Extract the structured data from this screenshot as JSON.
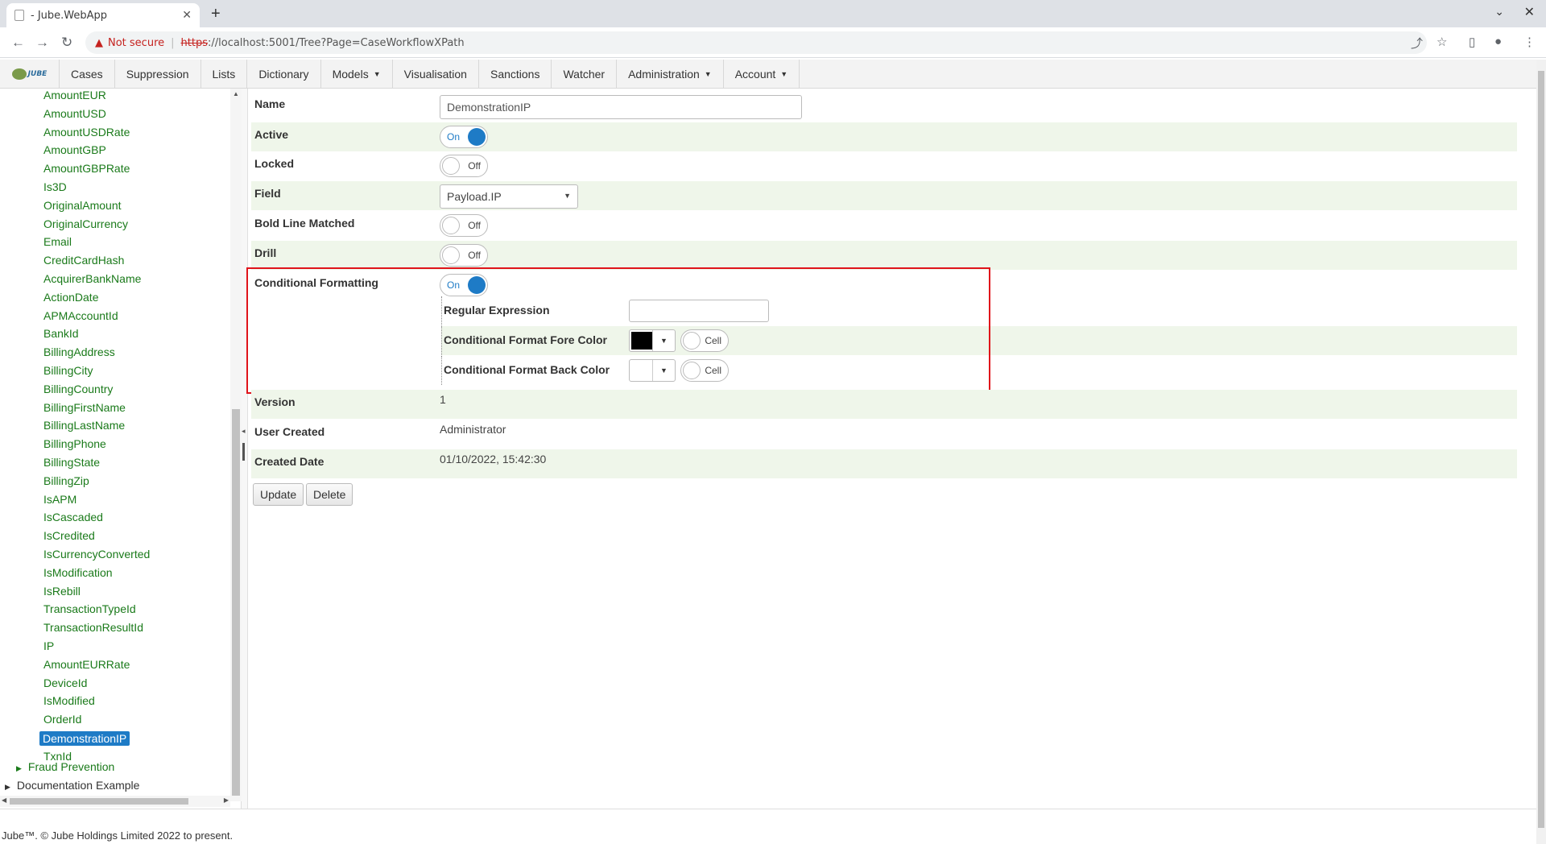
{
  "browser": {
    "tab_title": "- Jube.WebApp",
    "not_secure": "Not secure",
    "url_scheme": "https",
    "url_rest": "://localhost:5001/Tree?Page=CaseWorkflowXPath"
  },
  "nav": {
    "logo_text": "JUBE",
    "items": [
      {
        "label": "Cases",
        "dropdown": false
      },
      {
        "label": "Suppression",
        "dropdown": false
      },
      {
        "label": "Lists",
        "dropdown": false
      },
      {
        "label": "Dictionary",
        "dropdown": false
      },
      {
        "label": "Models",
        "dropdown": true
      },
      {
        "label": "Visualisation",
        "dropdown": false
      },
      {
        "label": "Sanctions",
        "dropdown": false
      },
      {
        "label": "Watcher",
        "dropdown": false
      },
      {
        "label": "Administration",
        "dropdown": true
      },
      {
        "label": "Account",
        "dropdown": true
      }
    ]
  },
  "tree": {
    "items": [
      "AmountEUR",
      "AmountUSD",
      "AmountUSDRate",
      "AmountGBP",
      "AmountGBPRate",
      "Is3D",
      "OriginalAmount",
      "OriginalCurrency",
      "Email",
      "CreditCardHash",
      "AcquirerBankName",
      "ActionDate",
      "APMAccountId",
      "BankId",
      "BillingAddress",
      "BillingCity",
      "BillingCountry",
      "BillingFirstName",
      "BillingLastName",
      "BillingPhone",
      "BillingState",
      "BillingZip",
      "IsAPM",
      "IsCascaded",
      "IsCredited",
      "IsCurrencyConverted",
      "IsModification",
      "IsRebill",
      "TransactionTypeId",
      "TransactionResultId",
      "IP",
      "AmountEURRate",
      "DeviceId",
      "IsModified",
      "OrderId",
      "DemonstrationIP",
      "TxnId"
    ],
    "selected": "DemonstrationIP",
    "fraud_prevention": "Fraud Prevention",
    "documentation_example": "Documentation Example"
  },
  "form": {
    "name_label": "Name",
    "name_value": "DemonstrationIP",
    "active_label": "Active",
    "active_state": "On",
    "locked_label": "Locked",
    "locked_state": "Off",
    "field_label": "Field",
    "field_value": "Payload.IP",
    "bold_label": "Bold Line Matched",
    "bold_state": "Off",
    "drill_label": "Drill",
    "drill_state": "Off",
    "cond_label": "Conditional Formatting",
    "cond_state": "On",
    "regex_label": "Regular Expression",
    "regex_value": "",
    "fore_label": "Conditional Format Fore Color",
    "fore_color": "#000000",
    "fore_cell": "Cell",
    "back_label": "Conditional Format Back Color",
    "back_color": "#ffffff",
    "back_cell": "Cell",
    "version_label": "Version",
    "version_value": "1",
    "user_label": "User Created",
    "user_value": "Administrator",
    "date_label": "Created Date",
    "date_value": "01/10/2022, 15:42:30",
    "update_button": "Update",
    "delete_button": "Delete"
  },
  "footer": "Jube™. © Jube Holdings Limited 2022 to present."
}
